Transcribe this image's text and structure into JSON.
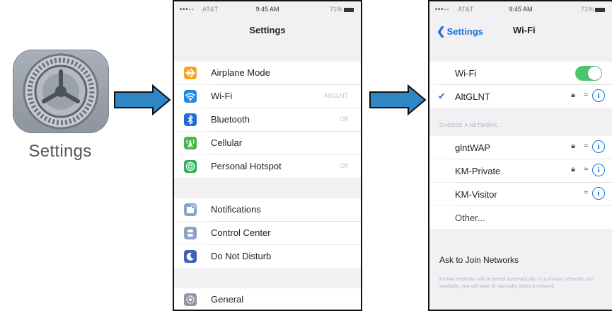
{
  "icon": {
    "name": "settings-gear-icon",
    "label": "Settings"
  },
  "status_bar": {
    "signal": "•••◦◦",
    "carrier": "AT&T",
    "time": "9:45 AM",
    "battery": "71%"
  },
  "settings_screen": {
    "title": "Settings",
    "group1": [
      {
        "label": "Airplane Mode",
        "icon": "airplane-icon",
        "color": "#f5a623",
        "value": ""
      },
      {
        "label": "Wi-Fi",
        "icon": "wifi-icon",
        "color": "#1e88e5",
        "value": "AltGLNT"
      },
      {
        "label": "Bluetooth",
        "icon": "bluetooth-icon",
        "color": "#1e6fd9",
        "value": "Off"
      },
      {
        "label": "Cellular",
        "icon": "cellular-icon",
        "color": "#43b649",
        "value": ""
      },
      {
        "label": "Personal Hotspot",
        "icon": "hotspot-icon",
        "color": "#2fb25a",
        "value": "Off"
      }
    ],
    "group2": [
      {
        "label": "Notifications",
        "icon": "notifications-icon",
        "color": "#8aa4c8"
      },
      {
        "label": "Control Center",
        "icon": "control-center-icon",
        "color": "#8aa4c8"
      },
      {
        "label": "Do Not Disturb",
        "icon": "moon-icon",
        "color": "#3d62b8"
      }
    ],
    "group3": [
      {
        "label": "General",
        "icon": "general-gear-icon",
        "color": "#8e96a2"
      }
    ]
  },
  "wifi_screen": {
    "back_label": "Settings",
    "title": "Wi-Fi",
    "wifi_toggle_label": "Wi-Fi",
    "wifi_on": true,
    "connected": {
      "name": "AltGLNT",
      "locked": true
    },
    "section_header": "CHOOSE A NETWORK...",
    "networks": [
      {
        "name": "glntWAP",
        "locked": true
      },
      {
        "name": "KM-Private",
        "locked": true
      },
      {
        "name": "KM-Visitor",
        "locked": false
      },
      {
        "name": "Other...",
        "locked": false
      }
    ],
    "ask_label": "Ask to Join Networks",
    "footer": "Known networks will be joined automatically. If no known networks are available, you will have to manually select a network."
  },
  "colors": {
    "accent": "#1a73d9",
    "toggle_on": "#4cc46a",
    "arrow": "#2f86c6"
  }
}
